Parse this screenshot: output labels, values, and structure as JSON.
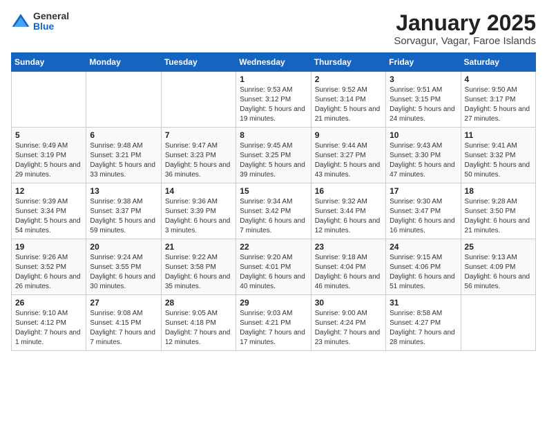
{
  "logo": {
    "general": "General",
    "blue": "Blue"
  },
  "title": "January 2025",
  "subtitle": "Sorvagur, Vagar, Faroe Islands",
  "days_of_week": [
    "Sunday",
    "Monday",
    "Tuesday",
    "Wednesday",
    "Thursday",
    "Friday",
    "Saturday"
  ],
  "weeks": [
    [
      {
        "day": "",
        "sunrise": "",
        "sunset": "",
        "daylight": ""
      },
      {
        "day": "",
        "sunrise": "",
        "sunset": "",
        "daylight": ""
      },
      {
        "day": "",
        "sunrise": "",
        "sunset": "",
        "daylight": ""
      },
      {
        "day": "1",
        "sunrise": "Sunrise: 9:53 AM",
        "sunset": "Sunset: 3:12 PM",
        "daylight": "Daylight: 5 hours and 19 minutes."
      },
      {
        "day": "2",
        "sunrise": "Sunrise: 9:52 AM",
        "sunset": "Sunset: 3:14 PM",
        "daylight": "Daylight: 5 hours and 21 minutes."
      },
      {
        "day": "3",
        "sunrise": "Sunrise: 9:51 AM",
        "sunset": "Sunset: 3:15 PM",
        "daylight": "Daylight: 5 hours and 24 minutes."
      },
      {
        "day": "4",
        "sunrise": "Sunrise: 9:50 AM",
        "sunset": "Sunset: 3:17 PM",
        "daylight": "Daylight: 5 hours and 27 minutes."
      }
    ],
    [
      {
        "day": "5",
        "sunrise": "Sunrise: 9:49 AM",
        "sunset": "Sunset: 3:19 PM",
        "daylight": "Daylight: 5 hours and 29 minutes."
      },
      {
        "day": "6",
        "sunrise": "Sunrise: 9:48 AM",
        "sunset": "Sunset: 3:21 PM",
        "daylight": "Daylight: 5 hours and 33 minutes."
      },
      {
        "day": "7",
        "sunrise": "Sunrise: 9:47 AM",
        "sunset": "Sunset: 3:23 PM",
        "daylight": "Daylight: 5 hours and 36 minutes."
      },
      {
        "day": "8",
        "sunrise": "Sunrise: 9:45 AM",
        "sunset": "Sunset: 3:25 PM",
        "daylight": "Daylight: 5 hours and 39 minutes."
      },
      {
        "day": "9",
        "sunrise": "Sunrise: 9:44 AM",
        "sunset": "Sunset: 3:27 PM",
        "daylight": "Daylight: 5 hours and 43 minutes."
      },
      {
        "day": "10",
        "sunrise": "Sunrise: 9:43 AM",
        "sunset": "Sunset: 3:30 PM",
        "daylight": "Daylight: 5 hours and 47 minutes."
      },
      {
        "day": "11",
        "sunrise": "Sunrise: 9:41 AM",
        "sunset": "Sunset: 3:32 PM",
        "daylight": "Daylight: 5 hours and 50 minutes."
      }
    ],
    [
      {
        "day": "12",
        "sunrise": "Sunrise: 9:39 AM",
        "sunset": "Sunset: 3:34 PM",
        "daylight": "Daylight: 5 hours and 54 minutes."
      },
      {
        "day": "13",
        "sunrise": "Sunrise: 9:38 AM",
        "sunset": "Sunset: 3:37 PM",
        "daylight": "Daylight: 5 hours and 59 minutes."
      },
      {
        "day": "14",
        "sunrise": "Sunrise: 9:36 AM",
        "sunset": "Sunset: 3:39 PM",
        "daylight": "Daylight: 6 hours and 3 minutes."
      },
      {
        "day": "15",
        "sunrise": "Sunrise: 9:34 AM",
        "sunset": "Sunset: 3:42 PM",
        "daylight": "Daylight: 6 hours and 7 minutes."
      },
      {
        "day": "16",
        "sunrise": "Sunrise: 9:32 AM",
        "sunset": "Sunset: 3:44 PM",
        "daylight": "Daylight: 6 hours and 12 minutes."
      },
      {
        "day": "17",
        "sunrise": "Sunrise: 9:30 AM",
        "sunset": "Sunset: 3:47 PM",
        "daylight": "Daylight: 6 hours and 16 minutes."
      },
      {
        "day": "18",
        "sunrise": "Sunrise: 9:28 AM",
        "sunset": "Sunset: 3:50 PM",
        "daylight": "Daylight: 6 hours and 21 minutes."
      }
    ],
    [
      {
        "day": "19",
        "sunrise": "Sunrise: 9:26 AM",
        "sunset": "Sunset: 3:52 PM",
        "daylight": "Daylight: 6 hours and 26 minutes."
      },
      {
        "day": "20",
        "sunrise": "Sunrise: 9:24 AM",
        "sunset": "Sunset: 3:55 PM",
        "daylight": "Daylight: 6 hours and 30 minutes."
      },
      {
        "day": "21",
        "sunrise": "Sunrise: 9:22 AM",
        "sunset": "Sunset: 3:58 PM",
        "daylight": "Daylight: 6 hours and 35 minutes."
      },
      {
        "day": "22",
        "sunrise": "Sunrise: 9:20 AM",
        "sunset": "Sunset: 4:01 PM",
        "daylight": "Daylight: 6 hours and 40 minutes."
      },
      {
        "day": "23",
        "sunrise": "Sunrise: 9:18 AM",
        "sunset": "Sunset: 4:04 PM",
        "daylight": "Daylight: 6 hours and 46 minutes."
      },
      {
        "day": "24",
        "sunrise": "Sunrise: 9:15 AM",
        "sunset": "Sunset: 4:06 PM",
        "daylight": "Daylight: 6 hours and 51 minutes."
      },
      {
        "day": "25",
        "sunrise": "Sunrise: 9:13 AM",
        "sunset": "Sunset: 4:09 PM",
        "daylight": "Daylight: 6 hours and 56 minutes."
      }
    ],
    [
      {
        "day": "26",
        "sunrise": "Sunrise: 9:10 AM",
        "sunset": "Sunset: 4:12 PM",
        "daylight": "Daylight: 7 hours and 1 minute."
      },
      {
        "day": "27",
        "sunrise": "Sunrise: 9:08 AM",
        "sunset": "Sunset: 4:15 PM",
        "daylight": "Daylight: 7 hours and 7 minutes."
      },
      {
        "day": "28",
        "sunrise": "Sunrise: 9:05 AM",
        "sunset": "Sunset: 4:18 PM",
        "daylight": "Daylight: 7 hours and 12 minutes."
      },
      {
        "day": "29",
        "sunrise": "Sunrise: 9:03 AM",
        "sunset": "Sunset: 4:21 PM",
        "daylight": "Daylight: 7 hours and 17 minutes."
      },
      {
        "day": "30",
        "sunrise": "Sunrise: 9:00 AM",
        "sunset": "Sunset: 4:24 PM",
        "daylight": "Daylight: 7 hours and 23 minutes."
      },
      {
        "day": "31",
        "sunrise": "Sunrise: 8:58 AM",
        "sunset": "Sunset: 4:27 PM",
        "daylight": "Daylight: 7 hours and 28 minutes."
      },
      {
        "day": "",
        "sunrise": "",
        "sunset": "",
        "daylight": ""
      }
    ]
  ]
}
